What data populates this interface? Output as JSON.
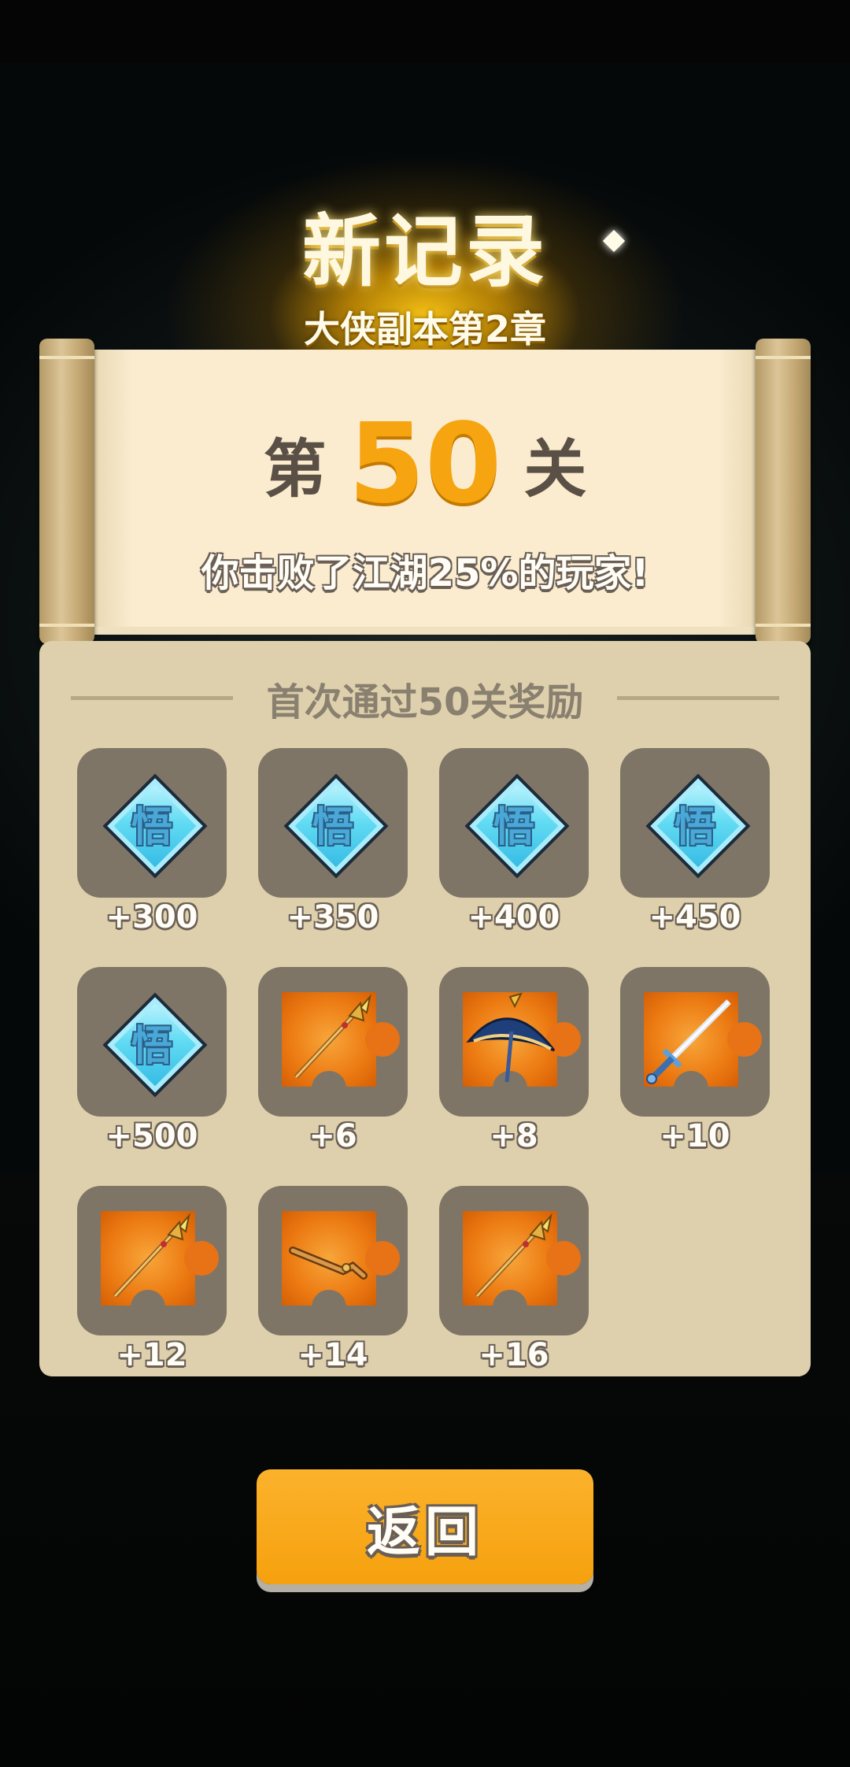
{
  "header": {
    "title": "新记录",
    "subtitle": "大侠副本第2章"
  },
  "level": {
    "prefix": "第",
    "number": "50",
    "suffix": "关",
    "defeat_text": "你击败了江湖25%的玩家!"
  },
  "rewards": {
    "title": "首次通过50关奖励",
    "items": [
      {
        "icon": "wu-gem-icon",
        "amount": "+300"
      },
      {
        "icon": "wu-gem-icon",
        "amount": "+350"
      },
      {
        "icon": "wu-gem-icon",
        "amount": "+400"
      },
      {
        "icon": "wu-gem-icon",
        "amount": "+450"
      },
      {
        "icon": "wu-gem-icon",
        "amount": "+500"
      },
      {
        "icon": "spear-fragment-icon",
        "amount": "+6"
      },
      {
        "icon": "umbrella-fragment-icon",
        "amount": "+8"
      },
      {
        "icon": "sword-fragment-icon",
        "amount": "+10"
      },
      {
        "icon": "spear-fragment-icon",
        "amount": "+12"
      },
      {
        "icon": "whip-fragment-icon",
        "amount": "+14"
      },
      {
        "icon": "spear-fragment-icon",
        "amount": "+16"
      }
    ],
    "gem_glyph": "悟"
  },
  "footer": {
    "back_label": "返回"
  },
  "colors": {
    "accent": "#f6a40f",
    "panel": "#ded0ac",
    "slot": "#7e7566"
  }
}
